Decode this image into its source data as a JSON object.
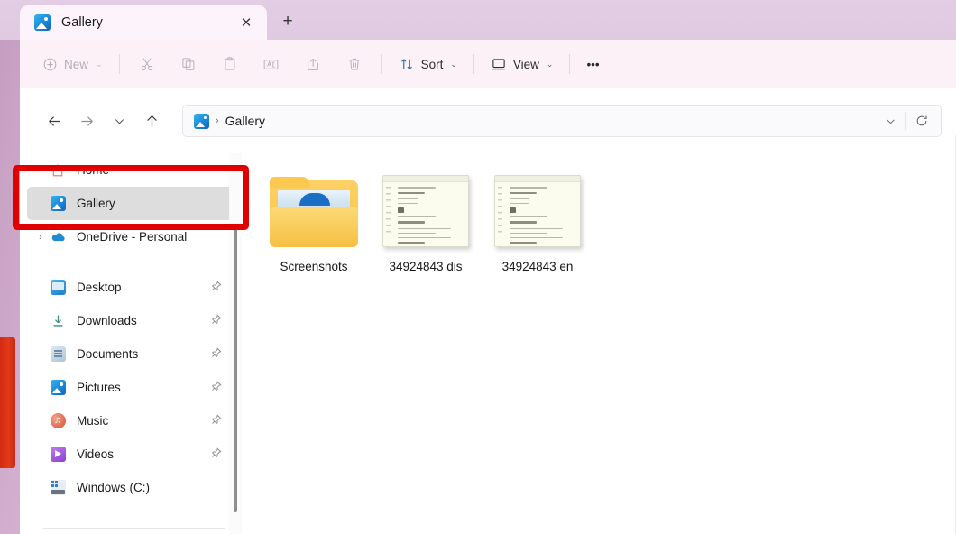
{
  "window": {
    "title": "Gallery",
    "titlebar_color": "#e2cde4",
    "toolbar_color": "#fdf1f8"
  },
  "tabs": {
    "items": [
      {
        "label": "Gallery",
        "icon": "gallery-picture-icon",
        "active": true
      }
    ],
    "close_label": "✕",
    "new_tab_label": "+"
  },
  "toolbar": {
    "new_label": "New",
    "new_caret": "⌄",
    "cut_label": "Cut",
    "copy_label": "Copy",
    "paste_label": "Paste",
    "rename_label": "Rename",
    "share_label": "Share",
    "delete_label": "Delete",
    "sort_label": "Sort",
    "sort_caret": "⌄",
    "view_label": "View",
    "view_caret": "⌄",
    "more_label": "•••"
  },
  "navigation": {
    "back_label": "←",
    "forward_label": "→",
    "recent_caret": "⌄",
    "up_label": "↑",
    "address": {
      "icon": "gallery-picture-icon",
      "separator": "›",
      "crumb": "Gallery",
      "dropdown_caret": "⌄",
      "refresh_label": "↻"
    }
  },
  "sidebar": {
    "items": [
      {
        "label": "Home",
        "icon": "home-icon",
        "twisty": "",
        "pinned": false,
        "selected": false
      },
      {
        "label": "Gallery",
        "icon": "gallery-picture-icon",
        "twisty": "",
        "pinned": false,
        "selected": true
      },
      {
        "label": "OneDrive - Personal",
        "icon": "onedrive-cloud-icon",
        "twisty": "›",
        "pinned": false,
        "selected": false
      },
      {
        "label": "Desktop",
        "icon": "desktop-icon",
        "twisty": "",
        "pinned": true,
        "selected": false
      },
      {
        "label": "Downloads",
        "icon": "downloads-arrow-icon",
        "twisty": "",
        "pinned": true,
        "selected": false
      },
      {
        "label": "Documents",
        "icon": "documents-icon",
        "twisty": "",
        "pinned": true,
        "selected": false
      },
      {
        "label": "Pictures",
        "icon": "pictures-icon",
        "twisty": "",
        "pinned": true,
        "selected": false
      },
      {
        "label": "Music",
        "icon": "music-icon",
        "twisty": "",
        "pinned": true,
        "selected": false
      },
      {
        "label": "Videos",
        "icon": "videos-icon",
        "twisty": "",
        "pinned": true,
        "selected": false
      },
      {
        "label": "Windows (C:)",
        "icon": "drive-icon",
        "twisty": "",
        "pinned": false,
        "selected": false
      }
    ],
    "pin_glyph": "📌"
  },
  "content": {
    "files": [
      {
        "name": "Screenshots",
        "type": "folder"
      },
      {
        "name": "34924843 dis",
        "type": "image"
      },
      {
        "name": "34924843 en",
        "type": "image"
      }
    ]
  },
  "annotation": {
    "color": "#e00000",
    "target": "sidebar-item-gallery"
  }
}
